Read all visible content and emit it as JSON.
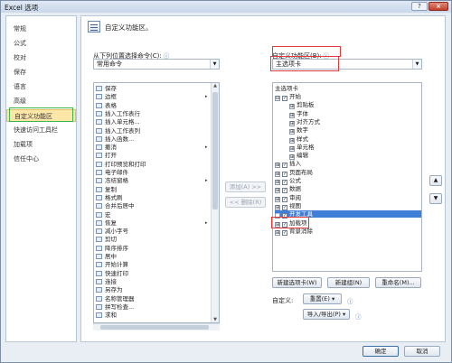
{
  "window": {
    "title": "Excel 选项",
    "help_label": "?",
    "close_label": "×"
  },
  "sidebar": {
    "items": [
      {
        "label": "常规"
      },
      {
        "label": "公式"
      },
      {
        "label": "校对"
      },
      {
        "label": "保存"
      },
      {
        "label": "语言"
      },
      {
        "label": "高级"
      },
      {
        "label": "自定义功能区",
        "selected": true
      },
      {
        "label": "快速访问工具栏"
      },
      {
        "label": "加载项"
      },
      {
        "label": "信任中心"
      }
    ]
  },
  "main": {
    "header_title": "自定义功能区。",
    "left_label": "从下列位置选择命令(C):",
    "left_info": "ⓘ",
    "left_select": "常用命令",
    "right_label": "自定义功能区(B):",
    "right_info": "ⓘ",
    "right_select": "主选项卡",
    "commands": [
      {
        "label": "保存"
      },
      {
        "label": "边框",
        "sub": "▸"
      },
      {
        "label": "表格"
      },
      {
        "label": "插入工作表行"
      },
      {
        "label": "插入单元格..."
      },
      {
        "label": "插入工作表列"
      },
      {
        "label": "插入函数..."
      },
      {
        "label": "撤消",
        "sub": "▸"
      },
      {
        "label": "打开"
      },
      {
        "label": "打印预览和打印"
      },
      {
        "label": "电子邮件"
      },
      {
        "label": "冻结窗格",
        "sub": "▸"
      },
      {
        "label": "复制"
      },
      {
        "label": "格式刷"
      },
      {
        "label": "合并后居中"
      },
      {
        "label": "宏"
      },
      {
        "label": "恢复",
        "sub": "▸"
      },
      {
        "label": "减小字号"
      },
      {
        "label": "剪切"
      },
      {
        "label": "降序排序"
      },
      {
        "label": "居中"
      },
      {
        "label": "开始计算"
      },
      {
        "label": "快速打印"
      },
      {
        "label": "连接"
      },
      {
        "label": "另存为"
      },
      {
        "label": "名称管理器"
      },
      {
        "label": "拼写检查..."
      },
      {
        "label": "求和"
      }
    ],
    "add_button": "添加(A) >>",
    "remove_button": "<< 删除(R)",
    "tree_header": "主选项卡",
    "tree": [
      {
        "label": "开始",
        "level": 0,
        "exp": "⊟",
        "checked": true
      },
      {
        "label": "剪贴板",
        "level": 1,
        "exp": "⊞"
      },
      {
        "label": "字体",
        "level": 1,
        "exp": "⊞"
      },
      {
        "label": "对齐方式",
        "level": 1,
        "exp": "⊞"
      },
      {
        "label": "数字",
        "level": 1,
        "exp": "⊞"
      },
      {
        "label": "样式",
        "level": 1,
        "exp": "⊞"
      },
      {
        "label": "单元格",
        "level": 1,
        "exp": "⊞"
      },
      {
        "label": "编辑",
        "level": 1,
        "exp": "⊞"
      },
      {
        "label": "插入",
        "level": 0,
        "exp": "⊞",
        "checked": true
      },
      {
        "label": "页面布局",
        "level": 0,
        "exp": "⊞",
        "checked": true
      },
      {
        "label": "公式",
        "level": 0,
        "exp": "⊞",
        "checked": true
      },
      {
        "label": "数据",
        "level": 0,
        "exp": "⊞",
        "checked": true
      },
      {
        "label": "审阅",
        "level": 0,
        "exp": "⊞",
        "checked": true
      },
      {
        "label": "视图",
        "level": 0,
        "exp": "⊞",
        "checked": true
      },
      {
        "label": "开发工具",
        "level": 0,
        "exp": "⊞",
        "checked": true,
        "selected": true
      },
      {
        "label": "加载项",
        "level": 0,
        "exp": "⊞",
        "checked": true
      },
      {
        "label": "背景消除",
        "level": 0,
        "exp": "⊞",
        "checked": true
      }
    ],
    "new_tab_button": "新建选项卡(W)",
    "new_group_button": "新建组(N)",
    "rename_button": "重命名(M)...",
    "customize_label": "自定义:",
    "reset_button": "重置(E) ▾",
    "reset_info": "ⓘ",
    "import_export_button": "导入/导出(P) ▾",
    "import_export_info": "ⓘ",
    "up_arrow": "▲",
    "down_arrow": "▼"
  },
  "footer": {
    "ok_button": "确定",
    "cancel_button": "取消"
  }
}
